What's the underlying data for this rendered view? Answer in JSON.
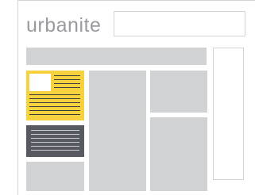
{
  "header": {
    "logo_text": "urbanite",
    "search": {
      "value": "",
      "placeholder": ""
    }
  },
  "colors": {
    "accent": "#f6d33e",
    "dark_block": "#575a60",
    "placeholder_block": "#d1d2d4",
    "border": "#d3d4d6",
    "logo": "#9a9b9e"
  }
}
